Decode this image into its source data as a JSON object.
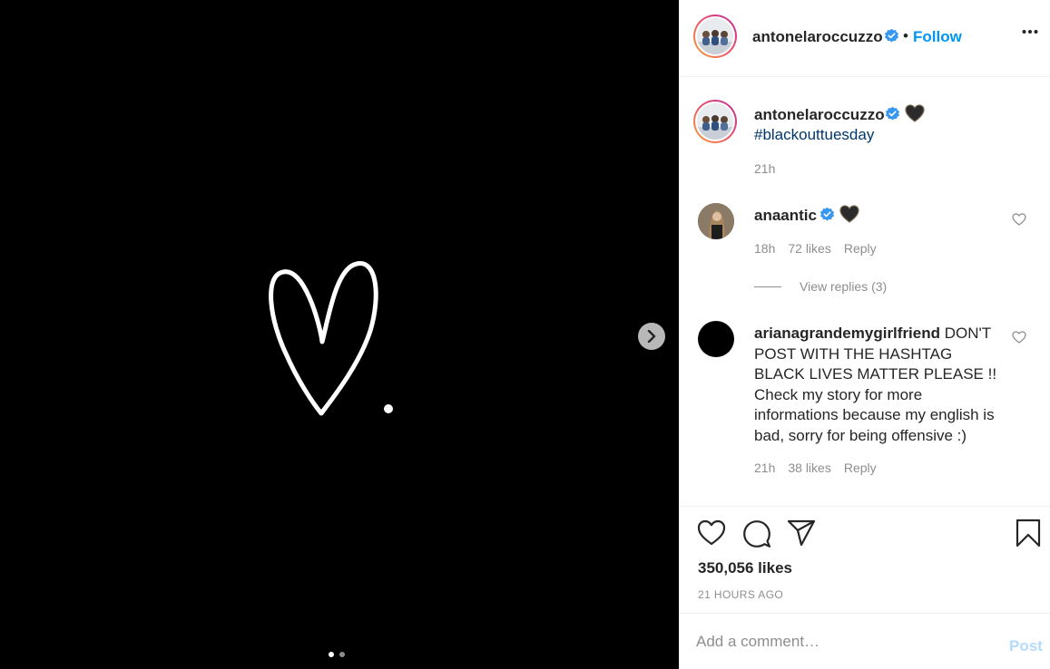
{
  "post": {
    "username": "antonelaroccuzzo",
    "follow_label": "Follow",
    "separator": "•",
    "caption_hashtag": "#blackouttuesday",
    "caption_time": "21h",
    "caption_emoji": "black-heart",
    "carousel": {
      "total_slides": 2,
      "current_slide": 1
    }
  },
  "comments": [
    {
      "username": "anaantic",
      "text": "",
      "time": "18h",
      "likes": "72 likes",
      "reply_label": "Reply",
      "view_replies": "View replies (3)"
    },
    {
      "username": "arianagrandemygirlfriend",
      "text": "DON'T POST WITH THE HASHTAG BLACK LIVES MATTER PLEASE !! Check my story for more informations because my english is bad, sorry for being offensive :)",
      "time": "21h",
      "likes": "38 likes",
      "reply_label": "Reply"
    }
  ],
  "footer": {
    "likes_count": "350,056 likes",
    "posted_ago": "21 HOURS AGO",
    "comment_placeholder": "Add a comment…",
    "post_label": "Post"
  },
  "colors": {
    "accent": "#0095f6",
    "hashtag": "#00376b",
    "muted": "#8e8e8e",
    "post_disabled": "#b3dbff",
    "verified": "#3897f0"
  }
}
